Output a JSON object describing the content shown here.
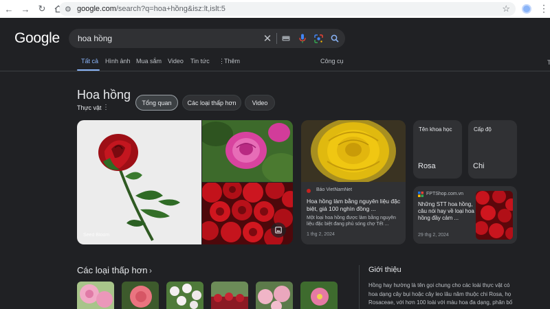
{
  "browser": {
    "url_main": "google.com",
    "url_rest": "/search?q=hoa+hồng&isz:lt,islt:5"
  },
  "google": {
    "logo_text": "Google",
    "query": "hoa hồng",
    "tabs": [
      {
        "label": "Tất cả",
        "active": true
      },
      {
        "label": "Hình ảnh"
      },
      {
        "label": "Mua sắm"
      },
      {
        "label": "Video"
      },
      {
        "label": "Tin tức"
      },
      {
        "label": "Thêm"
      }
    ],
    "tools_label": "Công cụ",
    "right_edge_text": "T"
  },
  "knowledge_panel": {
    "title": "Hoa hồng",
    "subtitle": "Thực vật",
    "chips": [
      "Tổng quan",
      "Các loại thấp hơn",
      "Video"
    ],
    "image_credit": "Seed Bloom",
    "news_card": {
      "source": "Báo VietNamNet",
      "title": "Hoa hồng làm bằng nguyên liệu đặc biệt, giá 100 nghìn đồng ...",
      "snippet": "Một loại hoa hồng được làm bằng nguyên liệu đặc biệt đang phủ sóng chợ Tết ...",
      "date": "1 thg 2, 2024"
    },
    "facts": [
      {
        "label": "Tên khoa học",
        "value": "Rosa"
      },
      {
        "label": "Cấp độ",
        "value": "Chi"
      }
    ],
    "news_card2": {
      "source": "FPTShop.com.vn",
      "title": "Những STT hoa hồng, câu nói hay về loại hoa hồng đầy cảm ...",
      "date": "29 thg 2, 2024"
    },
    "lower_section_title": "Các loại thấp hơn",
    "intro": {
      "title": "Giới thiệu",
      "text": "Hồng hay hường là tên gọi chung cho các loài thực vật có hoa dạng cây bụi hoặc cây leo lâu năm thuộc chi Rosa, họ Rosaceae, với hơn 100 loài với màu hoa đa dạng, phân bố"
    }
  },
  "colors": {
    "background": "#202124",
    "surface": "#303134",
    "accent": "#8ab4f8",
    "text": "#e8eaed"
  }
}
